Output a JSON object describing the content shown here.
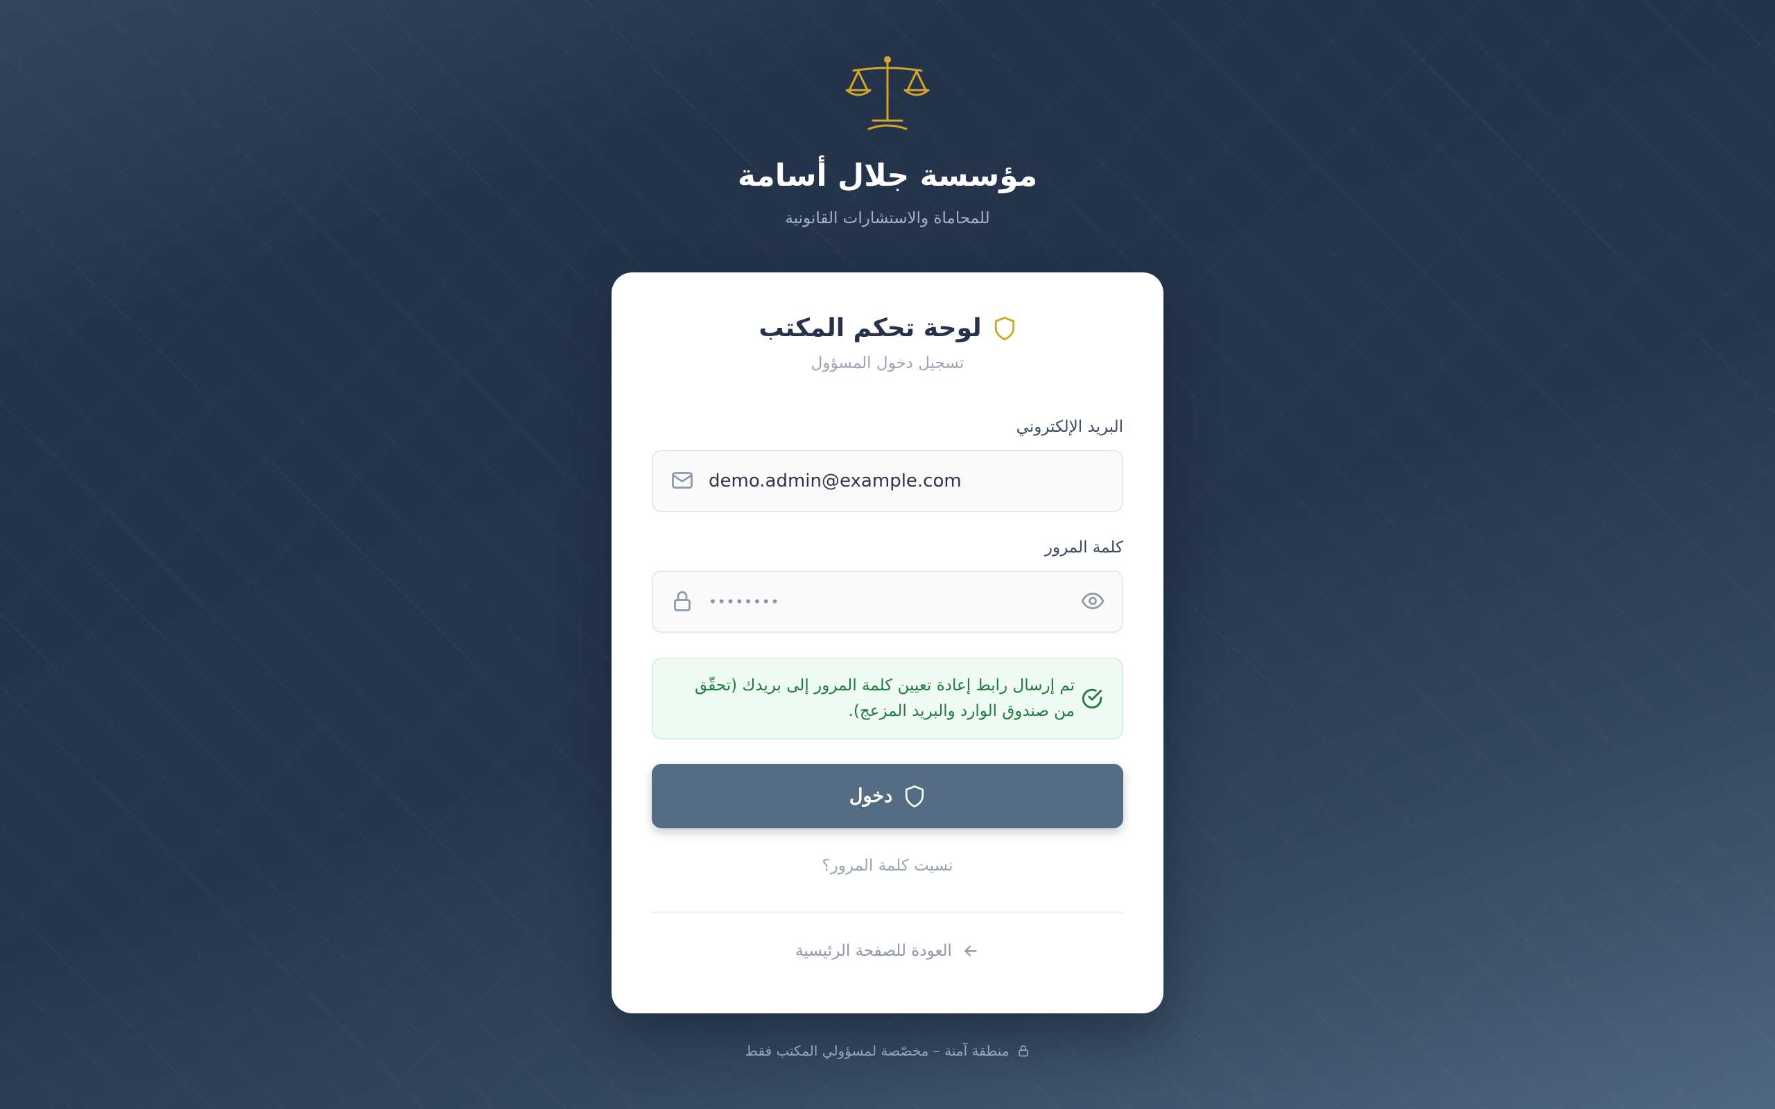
{
  "brand": {
    "title": "مؤسسة جلال أسامة",
    "subtitle": "للمحاماة والاستشارات القانونية",
    "logo_icon": "scales-of-justice-icon"
  },
  "card": {
    "title": "لوحة تحكم المكتب",
    "subtitle": "تسجيل دخول المسؤول",
    "title_icon": "shield-icon"
  },
  "form": {
    "email_label": "البريد الإلكتروني",
    "email_value": "demo.admin@example.com",
    "password_label": "كلمة المرور",
    "password_value": "••••••••",
    "submit_label": "دخول",
    "forgot_link": "نسيت كلمة المرور؟"
  },
  "alert": {
    "message": "تم إرسال رابط إعادة تعيين كلمة المرور إلى بريدك (تحقّق من صندوق الوارد والبريد المزعج)."
  },
  "back_link": "العودة للصفحة الرئيسية",
  "footer": {
    "text": "منطقة آمنة – مخصّصة لمسؤولي المكتب فقط"
  },
  "colors": {
    "accent_gold": "#d4a52c",
    "button": "#546c84",
    "success": "#1e7b43"
  }
}
